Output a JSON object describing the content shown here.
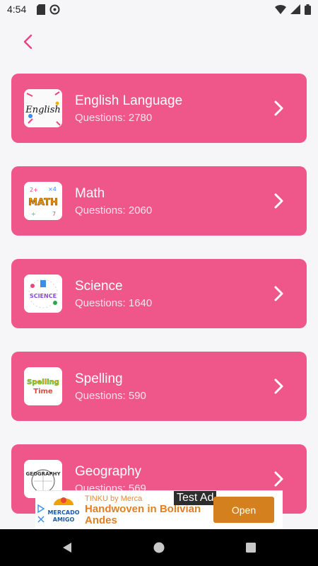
{
  "status_bar": {
    "time": "4:54"
  },
  "header": {
    "back_icon": "chevron-left-icon"
  },
  "categories": [
    {
      "title": "English Language",
      "questions": "Questions: 2780",
      "thumb_text": "English"
    },
    {
      "title": "Math",
      "questions": "Questions: 2060",
      "thumb_text": "MATH"
    },
    {
      "title": "Science",
      "questions": "Questions: 1640",
      "thumb_text": "SCIENCE"
    },
    {
      "title": "Spelling",
      "questions": "Questions: 590",
      "thumb_text": "Spelling Time"
    },
    {
      "title": "Geography",
      "questions": "Questions: 569",
      "thumb_text": "GEOGRAPHY"
    }
  ],
  "ad": {
    "label": "Test Ad",
    "brand": "TINKU by Merca",
    "headline": "Handwoven in Bolivian Andes",
    "logo_text": "MERCADO AMIGO",
    "button": "Open"
  },
  "colors": {
    "card": "#ef578b",
    "accent": "#e8457e",
    "ad_button": "#d4801e"
  }
}
